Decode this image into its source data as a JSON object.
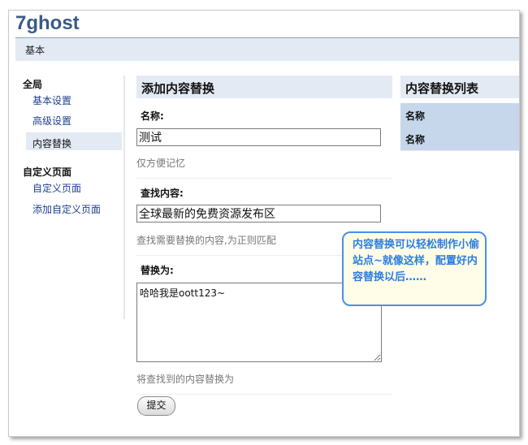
{
  "app": {
    "title": "7ghost"
  },
  "topbar": {
    "tab": "基本"
  },
  "sidebar": {
    "groups": [
      {
        "heading": "全局",
        "items": [
          "基本设置",
          "高级设置",
          "内容替换"
        ]
      },
      {
        "heading": "自定义页面",
        "items": [
          "自定义页面",
          "添加自定义页面"
        ]
      }
    ],
    "active_item": "内容替换"
  },
  "form": {
    "header": "添加内容替换",
    "name_label": "名称:",
    "name_value": "测试",
    "name_hint": "仅方便记忆",
    "find_label": "查找内容:",
    "find_value": "全球最新的免费资源发布区",
    "find_hint": "查找需要替换的内容,为正则匹配",
    "replace_label": "替换为:",
    "replace_value": "哈哈我是oott123~",
    "replace_hint": "将查找到的内容替换为",
    "submit_label": "提交"
  },
  "list": {
    "header": "内容替换列表",
    "rows": [
      "名称",
      "名称"
    ]
  },
  "callout": {
    "text": "内容替换可以轻松制作小偷站点~就像这样，配置好内容替换以后……"
  },
  "colors": {
    "accent": "#3b5a87",
    "panel": "#e3eaf3",
    "list_row": "#c6d6eb",
    "callout_border": "#4a90e2",
    "callout_text": "#2b7de0"
  }
}
